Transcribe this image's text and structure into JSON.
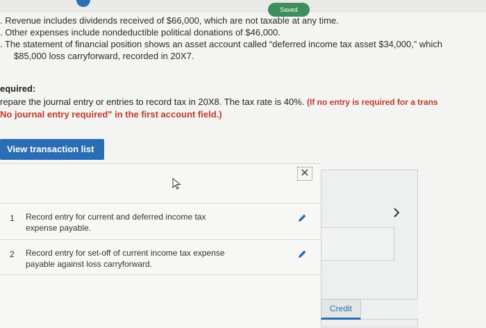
{
  "header": {
    "saved_label": "Saved"
  },
  "problem": {
    "line1": ". Revenue includes dividends received of $66,000, which are not taxable at any time.",
    "line2": ". Other expenses include nondeductible political donations of $46,000.",
    "line3": ". The statement of financial position shows an asset account called “deferred income tax asset $34,000,” which",
    "line4": "$85,000 loss carryforward, recorded in 20X7."
  },
  "required": {
    "heading": "equired:",
    "instruction": "repare the journal entry or entries to record tax in 20X8. The tax rate is 40%.",
    "instruction_red": "(If no entry is required for a trans",
    "instruction2": "No journal entry required\" in the first account field.)"
  },
  "toolbar": {
    "view_transaction_list": "View transaction list"
  },
  "panel": {
    "close_symbol": "✕"
  },
  "transactions": [
    {
      "num": "1",
      "line1": "Record entry for current and deferred income tax",
      "line2": "expense payable."
    },
    {
      "num": "2",
      "line1": "Record entry for set-off of current income tax expense",
      "line2": "payable against loss carryforward."
    }
  ],
  "journal": {
    "credit_label": "Credit"
  },
  "colors": {
    "accent": "#2a6db5",
    "saved": "#3f8d5b",
    "warning": "#c0392b"
  }
}
